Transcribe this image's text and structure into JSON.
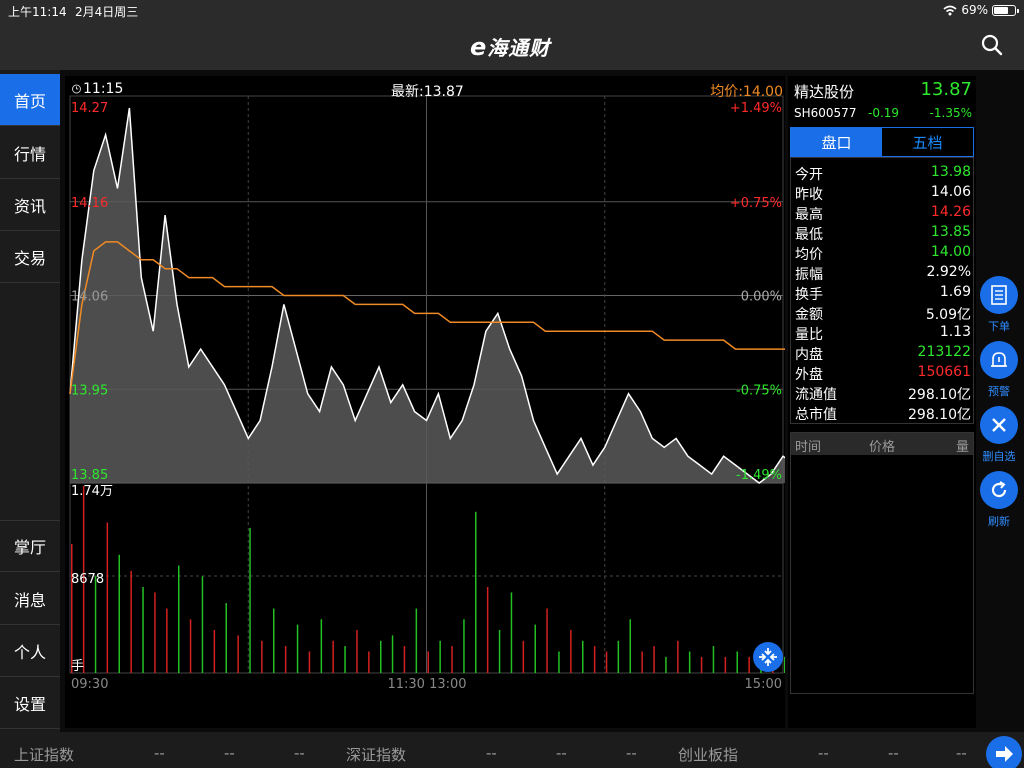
{
  "status_bar": {
    "time": "上午11:14",
    "date": "2月4日周三",
    "battery": "69%"
  },
  "nav": {
    "logo": "海通财",
    "logo_prefix": "e"
  },
  "sidebar": {
    "items": [
      {
        "label": "首页",
        "active": true
      },
      {
        "label": "行情",
        "active": false
      },
      {
        "label": "资讯",
        "active": false
      },
      {
        "label": "交易",
        "active": false
      }
    ],
    "bottom_items": [
      {
        "label": "掌厅"
      },
      {
        "label": "消息"
      },
      {
        "label": "个人"
      },
      {
        "label": "设置"
      }
    ]
  },
  "chart_header": {
    "time": "11:15",
    "latest": "最新:13.87",
    "avg": "均价:14.00"
  },
  "chart_data": {
    "type": "line",
    "price_axis_left": [
      "14.27",
      "14.16",
      "14.06",
      "13.95",
      "13.85"
    ],
    "price_axis_right": [
      "+1.49%",
      "+0.75%",
      "0.00%",
      "-0.75%",
      "-1.49%"
    ],
    "ylim": [
      13.85,
      14.27
    ],
    "x_ticks": [
      "09:30",
      "11:30 13:00",
      "15:00"
    ],
    "price_series": [
      13.95,
      14.1,
      14.2,
      14.24,
      14.18,
      14.27,
      14.08,
      14.02,
      14.15,
      14.05,
      13.98,
      14.0,
      13.98,
      13.96,
      13.93,
      13.9,
      13.92,
      13.98,
      14.05,
      14.0,
      13.95,
      13.93,
      13.98,
      13.96,
      13.92,
      13.95,
      13.98,
      13.94,
      13.96,
      13.93,
      13.92,
      13.95,
      13.9,
      13.92,
      13.96,
      14.02,
      14.04,
      14.0,
      13.97,
      13.92,
      13.89,
      13.86,
      13.88,
      13.9,
      13.87,
      13.89,
      13.92,
      13.95,
      13.93,
      13.9,
      13.89,
      13.9,
      13.88,
      13.87,
      13.86,
      13.88,
      13.87,
      13.86,
      13.85,
      13.86,
      13.88,
      13.87
    ],
    "avg_series": [
      13.95,
      14.05,
      14.11,
      14.12,
      14.12,
      14.11,
      14.1,
      14.1,
      14.09,
      14.09,
      14.08,
      14.08,
      14.08,
      14.07,
      14.07,
      14.07,
      14.07,
      14.07,
      14.06,
      14.06,
      14.06,
      14.06,
      14.06,
      14.06,
      14.05,
      14.05,
      14.05,
      14.05,
      14.05,
      14.04,
      14.04,
      14.04,
      14.03,
      14.03,
      14.03,
      14.03,
      14.03,
      14.03,
      14.03,
      14.03,
      14.02,
      14.02,
      14.02,
      14.02,
      14.02,
      14.02,
      14.02,
      14.02,
      14.02,
      14.02,
      14.01,
      14.01,
      14.01,
      14.01,
      14.01,
      14.01,
      14.0,
      14.0,
      14.0,
      14.0,
      14.0,
      14.0
    ],
    "volume_labels": {
      "top": "1.74万",
      "mid": "8678",
      "unit": "手"
    },
    "volume_max": 17400,
    "volume_series": [
      12000,
      17400,
      9000,
      14000,
      11000,
      9500,
      8000,
      7500,
      6000,
      10000,
      5000,
      9000,
      4000,
      6500,
      3500,
      13500,
      3000,
      6000,
      2500,
      4500,
      2000,
      5000,
      3000,
      2500,
      4000,
      2000,
      3000,
      3500,
      2500,
      6000,
      2000,
      3000,
      2500,
      5000,
      15000,
      8000,
      4000,
      7500,
      3000,
      4500,
      6000,
      2000,
      4000,
      3000,
      2500,
      2000,
      3000,
      5000,
      2000,
      2500,
      1500,
      3000,
      2000,
      1500,
      2500,
      1500,
      2000,
      1500,
      1200,
      2000,
      1500,
      1200
    ],
    "volume_colors": [
      "r",
      "r",
      "g",
      "r",
      "g",
      "r",
      "g",
      "r",
      "r",
      "g",
      "r",
      "g",
      "r",
      "g",
      "r",
      "g",
      "r",
      "g",
      "r",
      "g",
      "r",
      "g",
      "r",
      "g",
      "r",
      "r",
      "g",
      "g",
      "r",
      "g",
      "r",
      "g",
      "r",
      "g",
      "g",
      "r",
      "g",
      "g",
      "r",
      "g",
      "r",
      "g",
      "r",
      "g",
      "r",
      "r",
      "g",
      "g",
      "r",
      "r",
      "g",
      "r",
      "g",
      "r",
      "g",
      "r",
      "g",
      "r",
      "g",
      "r",
      "g",
      "g"
    ]
  },
  "stock": {
    "name": "精达股份",
    "price": "13.87",
    "code": "SH600577",
    "change": "-0.19",
    "pct": "-1.35%"
  },
  "tabs": [
    "盘口",
    "五档"
  ],
  "quotes": [
    {
      "label": "今开",
      "value": "13.98",
      "color": "#2ee82e"
    },
    {
      "label": "昨收",
      "value": "14.06",
      "color": "#ffffff"
    },
    {
      "label": "最高",
      "value": "14.26",
      "color": "#ff2a2a"
    },
    {
      "label": "最低",
      "value": "13.85",
      "color": "#2ee82e"
    },
    {
      "label": "均价",
      "value": "14.00",
      "color": "#2ee82e"
    },
    {
      "label": "振幅",
      "value": "2.92%",
      "color": "#ffffff"
    },
    {
      "label": "换手",
      "value": "1.69",
      "color": "#ffffff"
    },
    {
      "label": "金额",
      "value": "5.09亿",
      "color": "#ffffff"
    },
    {
      "label": "量比",
      "value": "1.13",
      "color": "#ffffff"
    },
    {
      "label": "内盘",
      "value": "213122",
      "color": "#2ee82e"
    },
    {
      "label": "外盘",
      "value": "150661",
      "color": "#ff2a2a"
    },
    {
      "label": "流通值",
      "value": "298.10亿",
      "color": "#ffffff"
    },
    {
      "label": "总市值",
      "value": "298.10亿",
      "color": "#ffffff"
    }
  ],
  "trades_header": {
    "time": "时间",
    "price": "价格",
    "volume": "量"
  },
  "float_buttons": [
    {
      "label": "下单",
      "icon": "order-icon"
    },
    {
      "label": "预警",
      "icon": "bell-icon"
    },
    {
      "label": "删自选",
      "icon": "close-icon"
    },
    {
      "label": "刷新",
      "icon": "refresh-icon"
    }
  ],
  "ticker": {
    "items": [
      {
        "name": "上证指数",
        "v1": "--",
        "v2": "--",
        "v3": "--"
      },
      {
        "name": "深证指数",
        "v1": "--",
        "v2": "--",
        "v3": "--"
      },
      {
        "name": "创业板指",
        "v1": "--",
        "v2": "--",
        "v3": "--"
      }
    ]
  },
  "colors": {
    "accent": "#1a6fe8",
    "up": "#ff2a2a",
    "down": "#2ee82e",
    "avg_line": "#f08a24"
  }
}
